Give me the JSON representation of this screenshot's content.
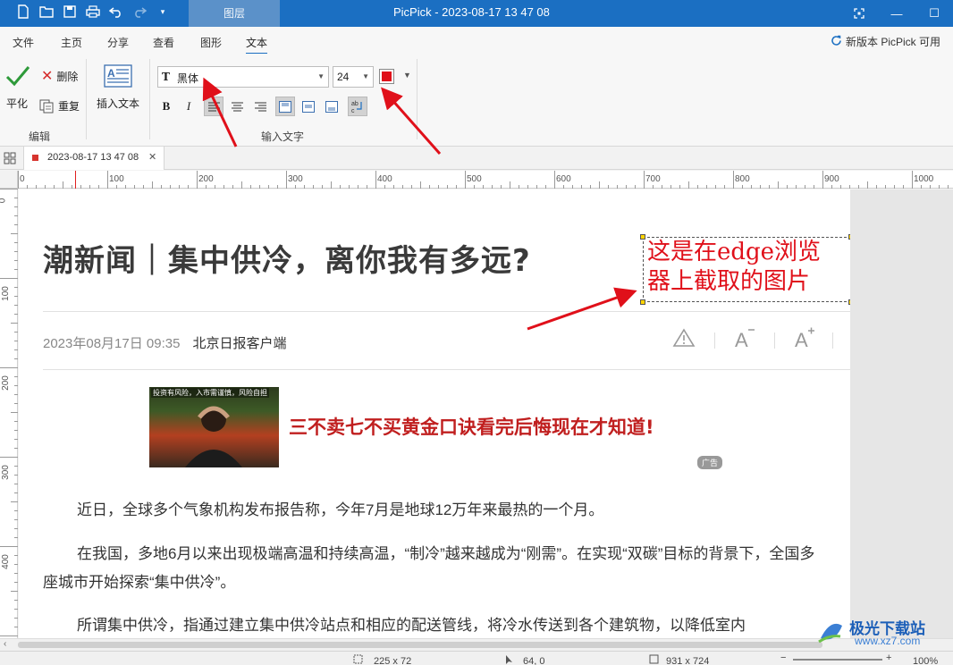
{
  "titlebar": {
    "layer_tab": "图层",
    "title": "PicPick - 2023-08-17 13 47 08",
    "quick_icons": [
      "new-file-icon",
      "open-folder-icon",
      "save-icon",
      "print-icon",
      "undo-icon",
      "redo-icon",
      "dropdown-icon"
    ]
  },
  "ribbon_tabs": [
    "文件",
    "主页",
    "分享",
    "查看",
    "图形",
    "文本"
  ],
  "active_tab": "文本",
  "new_version": "新版本 PicPick 可用",
  "ribbon": {
    "apply_label": "平化",
    "delete_label": "删除",
    "repeat_label": "重复",
    "edit_group": "编辑",
    "insert_text_label": "插入文本",
    "font_value": "黑体",
    "size_value": "24",
    "text_color": "#e0101a",
    "input_group": "输入文字"
  },
  "doc_tab": {
    "name": "2023-08-17 13 47 08"
  },
  "ruler": {
    "h_labels": [
      "0",
      "100",
      "200",
      "300",
      "400",
      "500",
      "600",
      "700",
      "800",
      "900",
      "1000"
    ],
    "v_labels": [
      "0",
      "100",
      "200",
      "300",
      "400"
    ]
  },
  "page": {
    "headline": "潮新闻｜集中供冷，离你我有多远?",
    "annotation": "这是在edge浏览\n器上截取的图片",
    "date": "2023年08月17日 09:35",
    "source": "北京日报客户端",
    "ad_caption": "投资有风险，入市需谨慎，风险自担",
    "ad_text": "三不卖七不买黄金口诀看完后悔现在才知道!",
    "ad_badge": "广告",
    "paragraphs": [
      "近日，全球多个气象机构发布报告称，今年7月是地球12万年来最热的一个月。",
      "在我国，多地6月以来出现极端高温和持续高温，“制冷”越来越成为“刚需”。在实现“双碳”目标的背景下，全国多座城市开始探索“集中供冷”。",
      "所谓集中供冷，指通过建立集中供冷站点和相应的配送管线，将冷水传送到各个建筑物，以降低室内"
    ]
  },
  "status": {
    "selection_size": "225 x 72",
    "cursor_pos": "64, 0",
    "image_size": "931 x 724",
    "zoom": "100%"
  },
  "watermark": {
    "text": "极光下载站",
    "url": "www.xz7.com"
  }
}
